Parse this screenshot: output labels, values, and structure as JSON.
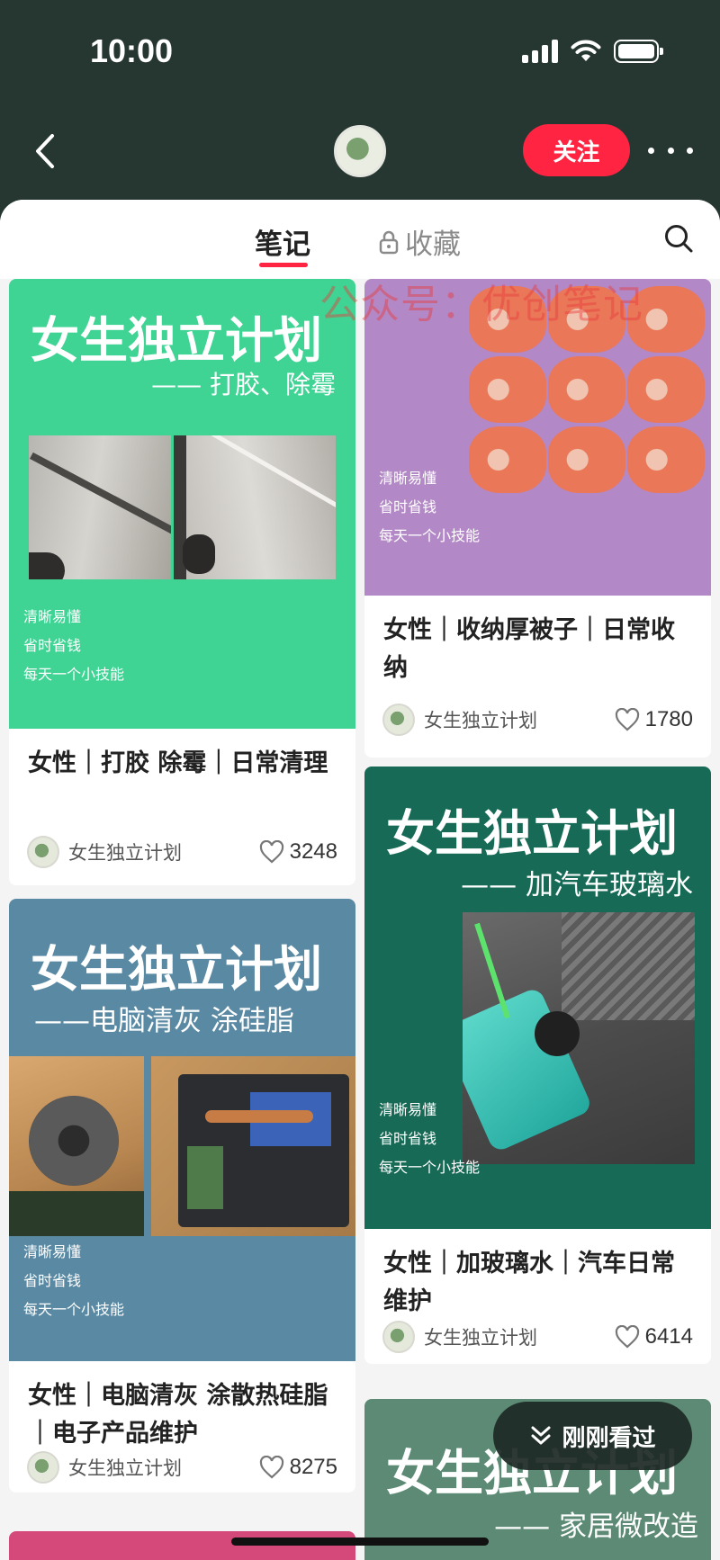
{
  "status_bar": {
    "time": "10:00"
  },
  "nav": {
    "follow_label": "关注"
  },
  "tabs": {
    "notes": "笔记",
    "collections": "收藏"
  },
  "watermark": "公众号：优创笔记",
  "cover_common": {
    "brand": "女生独立计划",
    "tagline": [
      "清晰易懂",
      "省时省钱",
      "每天一个小技能"
    ]
  },
  "cards": [
    {
      "cover_subtitle": "—— 打胶、除霉",
      "title": "女性｜打胶 除霉｜日常清理",
      "author": "女生独立计划",
      "likes": "3248",
      "cover_color": "#3fd494"
    },
    {
      "title": "女性｜收纳厚被子｜日常收纳",
      "author": "女生独立计划",
      "likes": "1780",
      "cover_color": "#b388c6"
    },
    {
      "cover_subtitle": "——电脑清灰 涂硅脂",
      "title": "女性｜电脑清灰 涂散热硅脂｜电子产品维护",
      "author": "女生独立计划",
      "likes": "8275",
      "cover_color": "#5a8aa3"
    },
    {
      "cover_subtitle": "—— 加汽车玻璃水",
      "title": "女性｜加玻璃水｜汽车日常维护",
      "author": "女生独立计划",
      "likes": "6414",
      "cover_color": "#176b56"
    },
    {
      "cover_subtitle": "—— 家居微改造",
      "cover_color": "#5c8a74"
    }
  ],
  "recent_button": "刚刚看过"
}
